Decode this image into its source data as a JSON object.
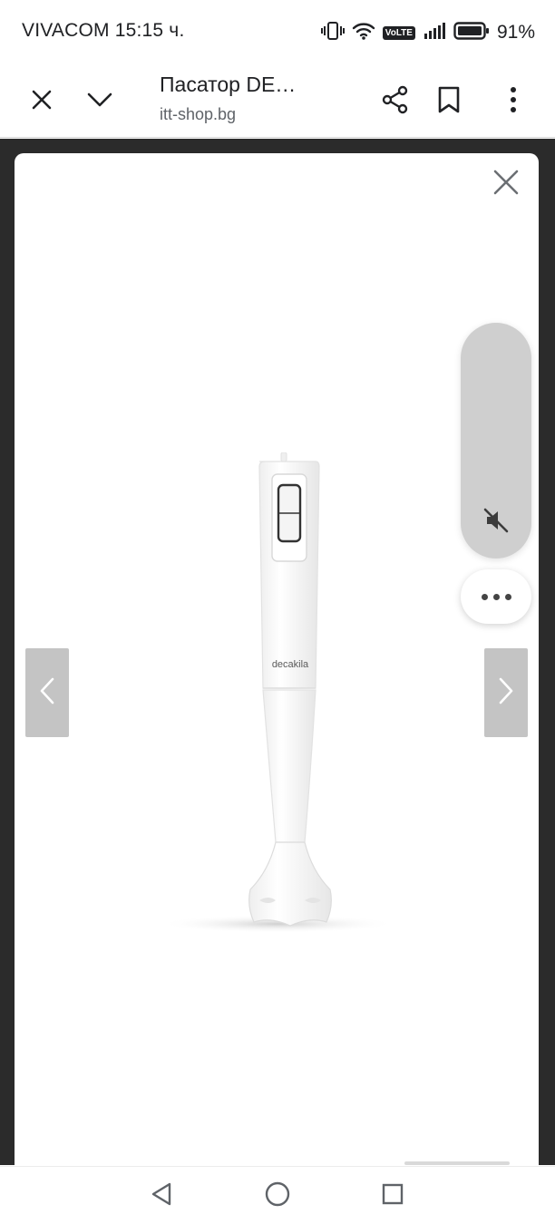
{
  "status_bar": {
    "carrier_time": "VIVACOM 15:15 ч.",
    "volte": "VoLTE",
    "battery": "91%"
  },
  "toolbar": {
    "title": "Пасатор DE…",
    "url": "itt-shop.bg",
    "icons": [
      "close-icon",
      "chevron-down-icon",
      "share-icon",
      "bookmark-icon",
      "more-vert-icon"
    ]
  },
  "lightbox": {
    "brand_text": "decakila",
    "icons": [
      "close-icon",
      "chevron-left-icon",
      "chevron-right-icon"
    ]
  },
  "volume_panel": {
    "icons": [
      "volume-off-icon",
      "more-horiz-icon"
    ]
  },
  "nav_bar": {
    "icons": [
      "back-triangle-icon",
      "home-circle-icon",
      "recents-square-icon"
    ]
  },
  "colors": {
    "overlay": "#2b2b2b",
    "nav_arrow_bg": "#c4c4c4",
    "volume_panel_bg": "#cfcfcf",
    "text_primary": "#202124",
    "text_secondary": "#5f6368"
  }
}
